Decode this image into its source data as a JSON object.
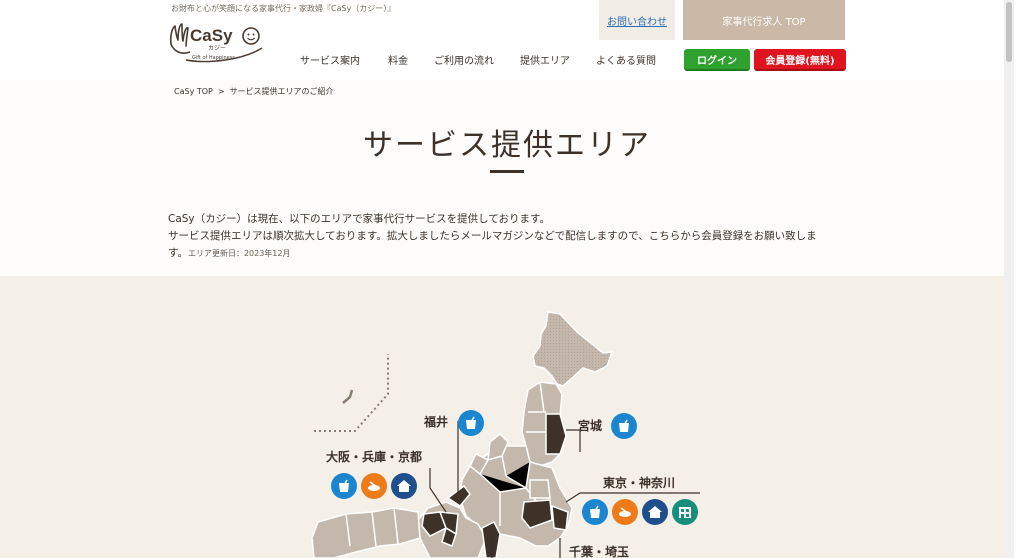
{
  "header": {
    "tagline": "お財布と心が笑顔になる家事代行・家政婦『CaSy（カジー）』",
    "logo": {
      "name": "CaSy",
      "sub": "カジー",
      "gift": "Gift of Happiness"
    },
    "nav": [
      "サービス案内",
      "料金",
      "ご利用の流れ",
      "提供エリア",
      "よくある質問"
    ],
    "contact_label": "お問い合わせ",
    "recruit_label": "家事代行求人 TOP",
    "login_label": "ログイン",
    "register_label": "会員登録(無料)"
  },
  "breadcrumb": {
    "home": "CaSy TOP",
    "separator": ">",
    "current": "サービス提供エリアのご紹介"
  },
  "page_title": "サービス提供エリア",
  "intro": {
    "line1": "CaSy（カジー）は現在、以下のエリアで家事代行サービスを提供しております。",
    "line2": "サービス提供エリアは順次拡大しております。拡大しましたらメールマガジンなどで配信しますので、こちらから会員登録をお願い致しま",
    "line3": "す。",
    "updated": "エリア更新日：2023年12月"
  },
  "regions": {
    "fukui": "福井",
    "miyagi": "宮城",
    "kansai": "大阪・兵庫・京都",
    "tokyo": "東京・神奈川",
    "chiba": "千葉・埼玉"
  },
  "icons": {
    "cleaning": "cleaning-icon",
    "cooking": "cooking-icon",
    "house": "house-icon",
    "office": "office-icon"
  },
  "colors": {
    "brown": "#3d3128",
    "login_green": "#2ea12e",
    "register_red": "#e0141e",
    "icon_blue": "#1b86cf",
    "icon_orange": "#ee7b1a",
    "icon_navy": "#1f4f8c",
    "icon_teal": "#178e7b"
  }
}
